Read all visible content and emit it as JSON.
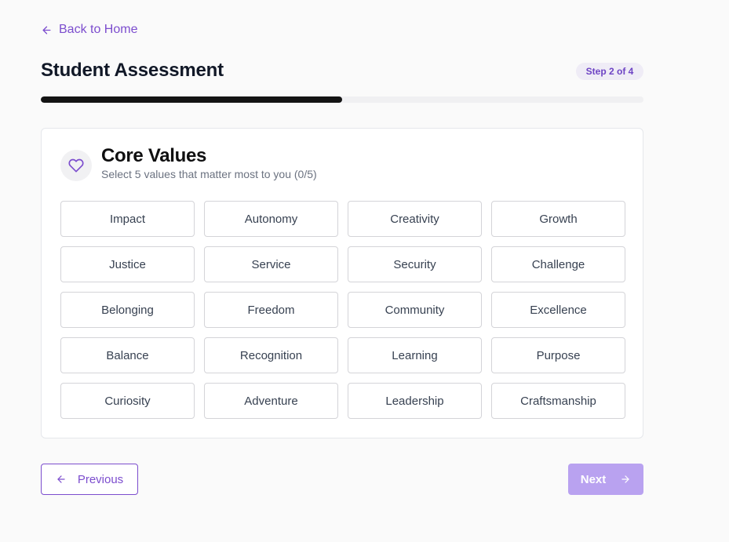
{
  "nav": {
    "back_label": "Back to Home"
  },
  "header": {
    "title": "Student Assessment",
    "step_badge": "Step 2 of 4"
  },
  "progress": {
    "fraction": 0.5
  },
  "card": {
    "title": "Core Values",
    "subtitle": "Select 5 values that matter most to you (0/5)",
    "icon": "heart-icon",
    "values": [
      "Impact",
      "Autonomy",
      "Creativity",
      "Growth",
      "Justice",
      "Service",
      "Security",
      "Challenge",
      "Belonging",
      "Freedom",
      "Community",
      "Excellence",
      "Balance",
      "Recognition",
      "Learning",
      "Purpose",
      "Curiosity",
      "Adventure",
      "Leadership",
      "Craftsmanship"
    ]
  },
  "footer": {
    "previous_label": "Previous",
    "next_label": "Next",
    "next_disabled": true
  },
  "colors": {
    "accent": "#7c4dce",
    "accent_disabled": "#b9a2f0",
    "progress_fill": "#141414"
  }
}
